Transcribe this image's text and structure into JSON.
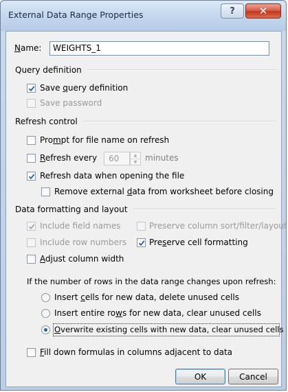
{
  "window": {
    "title": "External Data Range Properties",
    "help_label": "?",
    "close_label": "✕"
  },
  "name": {
    "label_first": "N",
    "label_rest": "ame:",
    "value": "WEIGHTS_1"
  },
  "query_definition": {
    "heading": "Query definition",
    "save_query": {
      "pre": "Save ",
      "key": "q",
      "post": "uery definition",
      "checked": true,
      "enabled": true
    },
    "save_password": {
      "label": "Save password",
      "checked": false,
      "enabled": false
    }
  },
  "refresh_control": {
    "heading": "Refresh control",
    "prompt_file_name": {
      "pre": "Pro",
      "key": "m",
      "post": "pt for file name on refresh",
      "checked": false
    },
    "refresh_every": {
      "pre": "",
      "key": "R",
      "post": "efresh every",
      "checked": false,
      "value": "60",
      "units": "minutes"
    },
    "refresh_on_open": {
      "pre": "Refresh data when opening the f",
      "key": "i",
      "post": "le",
      "checked": true
    },
    "remove_external": {
      "pre": "Remove external ",
      "key": "d",
      "post": "ata from worksheet before closing",
      "checked": false
    }
  },
  "formatting": {
    "heading": "Data formatting and layout",
    "include_field_names": {
      "label": "Include field names",
      "checked": true,
      "enabled": false
    },
    "preserve_sort": {
      "label": "Preserve column sort/filter/layout",
      "checked": false,
      "enabled": false
    },
    "include_row_numbers": {
      "label": "Include row numbers",
      "checked": false,
      "enabled": false
    },
    "preserve_cell_formatting": {
      "pre": "Pre",
      "key": "s",
      "post": "erve cell formatting",
      "checked": true
    },
    "adjust_column_width": {
      "pre": "",
      "key": "A",
      "post": "djust column width",
      "checked": false
    }
  },
  "rows_change": {
    "question": "If the number of rows in the data range changes upon refresh:",
    "options": [
      {
        "pre": "Insert ",
        "key": "c",
        "post": "ells for new data, delete unused cells",
        "selected": false
      },
      {
        "pre": "Insert entire ro",
        "key": "w",
        "post": "s for new data, clear unused cells",
        "selected": false
      },
      {
        "pre": "",
        "key": "O",
        "post": "verwrite existing cells with new data, clear unused cells",
        "selected": true
      }
    ]
  },
  "fill_down": {
    "pre": "",
    "key": "F",
    "post": "ill down formulas in columns adjacent to data",
    "checked": false
  },
  "buttons": {
    "ok": "OK",
    "cancel": "Cancel"
  }
}
